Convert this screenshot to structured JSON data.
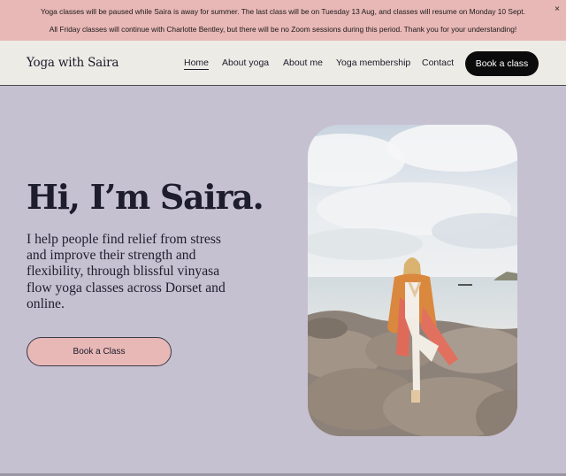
{
  "announcement": {
    "line1": "Yoga classes will be paused while Saira is away for summer. The last class will be on Tuesday 13 Aug, and classes will resume on Monday 10 Sept.",
    "line2": "All Friday classes will continue with Charlotte Bentley, but there will be no Zoom sessions during this period. Thank you for your understanding!",
    "close_label": "×"
  },
  "header": {
    "logo": "Yoga with Saira",
    "nav": {
      "home": "Home",
      "about_yoga": "About yoga",
      "about_me": "About me",
      "membership": "Yoga membership",
      "contact": "Contact"
    },
    "cta": "Book a class"
  },
  "hero": {
    "title": "Hi, I’m Saira.",
    "text": "I help people find relief from stress and improve their strength and flexibility, through blissful vinyasa flow yoga classes across Dorset and online.",
    "button": "Book a Class"
  },
  "colors": {
    "announcement_bg": "#e8b8b6",
    "header_bg": "#edebe6",
    "hero_bg": "#c6c1d0",
    "button_dark": "#0b0b0b",
    "button_pink": "#e8b8b6"
  }
}
